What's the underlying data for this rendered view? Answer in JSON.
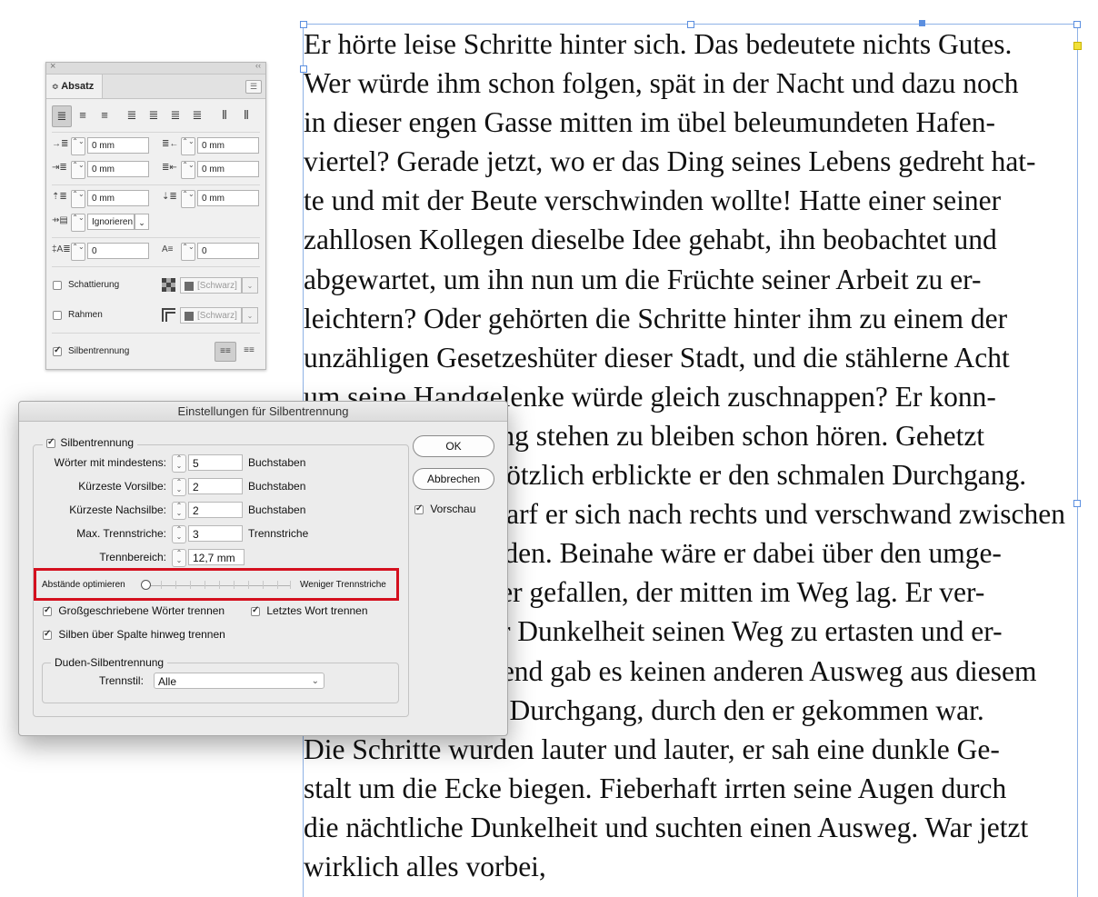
{
  "story": {
    "lines": [
      "Er hörte leise Schritte hinter sich. Das bedeutete nichts Gutes.",
      "Wer würde ihm schon folgen, spät in der Nacht und dazu noch",
      "in dieser engen Gasse mitten im übel beleumundeten Hafen-",
      "viertel? Gerade jetzt, wo er das Ding seines Lebens gedreht hat-",
      "te und mit der Beute verschwinden wollte! Hatte einer seiner",
      "zahllosen Kollegen dieselbe Idee gehabt, ihn beobachtet und",
      "abgewartet, um ihn nun um die Früchte seiner Arbeit zu er-",
      "leichtern? Oder gehörten die Schritte hinter ihm zu einem der",
      "unzähligen Gesetzeshüter dieser Stadt, und die stählerne Acht",
      "um seine Handgelenke würde gleich zuschnappen? Er konn-",
      "te die Aufforderung stehen zu bleiben schon hören. Gehetzt",
      "sah er sich um. Plötzlich erblickte er den schmalen Durchgang.",
      "Mit einem Satz warf er sich nach rechts und verschwand zwischen",
      "den hohen Gebäuden. Beinahe wäre er dabei über den umge-",
      "stürzten Mülleimer gefallen, der mitten im Weg lag. Er ver-",
      "suchte, sich in der Dunkelheit seinen Weg zu ertasten und er-",
      "kannte: Anscheinend gab es keinen anderen Ausweg aus diesem",
      "Hinterhof als den Durchgang, durch den er gekommen war.",
      "Die Schritte wurden lauter und lauter, er sah eine dunkle Ge-",
      "stalt um die Ecke biegen. Fieberhaft irrten seine Augen durch",
      "die nächtliche Dunkelheit und suchten einen Ausweg. War jetzt",
      "wirklich alles vorbei,"
    ]
  },
  "paragraph_panel": {
    "close_glyph": "×",
    "collapse_glyph": "‹‹",
    "tab_label": "Absatz",
    "tab_glyph": "≎",
    "menu_glyph": "☰",
    "left_indent": "0 mm",
    "right_indent": "0 mm",
    "first_line_indent": "0 mm",
    "last_line_indent": "0 mm",
    "space_before": "0 mm",
    "space_after": "0 mm",
    "align_to_grid": "Ignorieren",
    "drop_cap_lines": "0",
    "drop_cap_chars": "0",
    "shading_label": "Schattierung",
    "border_label": "Rahmen",
    "swatch_label": "[Schwarz]",
    "hyphenation_label": "Silbentrennung",
    "glyphs": {
      "align_left": "≣",
      "align_center": "≡",
      "align_right": "≡",
      "justify_left": "≣",
      "justify_center": "≣",
      "justify_right": "≣",
      "justify_all": "≣",
      "align_spine": "⫴",
      "align_away": "⫴",
      "left_indent": "→≣",
      "right_indent": "≣←",
      "first_line": "⇥≣",
      "last_line": "≣⇤",
      "space_before": "⇡≣",
      "space_after": "⇣≣",
      "grid": "⇸▤",
      "drop_lines": "‡A≣",
      "drop_chars": "A≡",
      "spin": "⌃⌄",
      "dropdown": "⌄",
      "single_line": "≡≡",
      "multi_line": "≡≡"
    }
  },
  "hyphenation_dialog": {
    "title": "Einstellungen für Silbentrennung",
    "hyphenate_label": "Silbentrennung",
    "words_min_label": "Wörter mit mindestens:",
    "words_min_value": "5",
    "words_min_unit": "Buchstaben",
    "shortest_before_label": "Kürzeste Vorsilbe:",
    "shortest_before_value": "2",
    "shortest_before_unit": "Buchstaben",
    "shortest_after_label": "Kürzeste Nachsilbe:",
    "shortest_after_value": "2",
    "shortest_after_unit": "Buchstaben",
    "limit_label": "Max. Trennstriche:",
    "limit_value": "3",
    "limit_unit": "Trennstriche",
    "zone_label": "Trennbereich:",
    "zone_value": "12,7 mm",
    "slider_left": "Abstände optimieren",
    "slider_right": "Weniger Trennstriche",
    "slider_position": 0,
    "capitalized_label": "Großgeschriebene Wörter trennen",
    "last_word_label": "Letztes Wort trennen",
    "across_column_label": "Silben über Spalte hinweg trennen",
    "duden_group_label": "Duden-Silbentrennung",
    "style_label": "Trennstil:",
    "style_value": "Alle",
    "ok_label": "OK",
    "cancel_label": "Abbrechen",
    "preview_label": "Vorschau",
    "highlight_color": "#d4101e"
  }
}
